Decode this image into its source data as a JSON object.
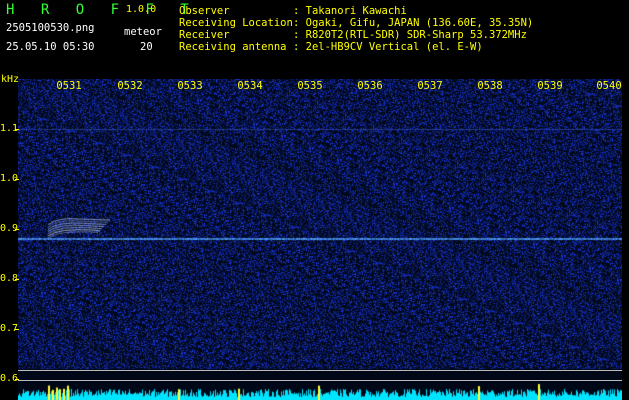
{
  "header": {
    "app_title": "H R O F F T",
    "version": "1.0.0",
    "filename": "2505100530.png",
    "datetime": "25.05.10 05:30",
    "meteor_label": "meteor",
    "meteor_count": "20",
    "fields": [
      {
        "label": "Observer",
        "value": ": Takanori Kawachi"
      },
      {
        "label": "Receiving Location",
        "value": ": Ogaki, Gifu, JAPAN (136.60E, 35.35N)"
      },
      {
        "label": "Receiver",
        "value": ": R820T2(RTL-SDR) SDR-Sharp 53.372MHz"
      },
      {
        "label": "Receiving antenna",
        "value": ": 2el-HB9CV Vertical (el. E-W)"
      }
    ]
  },
  "plot": {
    "unit": "kHz",
    "time_labels": [
      "0531",
      "0532",
      "0533",
      "0534",
      "0535",
      "0536",
      "0537",
      "0538",
      "0539",
      "0540"
    ],
    "freq_labels": [
      "1.1",
      "1.0",
      "0.9",
      "0.8",
      "0.7",
      "0.6"
    ],
    "colors": {
      "background": "#000818",
      "noise": "#1a3cff",
      "carrier": "#4aa0ff",
      "meteor": "#cfe0ff",
      "spectrum_cyan": "#00e5ff",
      "spectrum_yellow": "#ffff33"
    }
  }
}
